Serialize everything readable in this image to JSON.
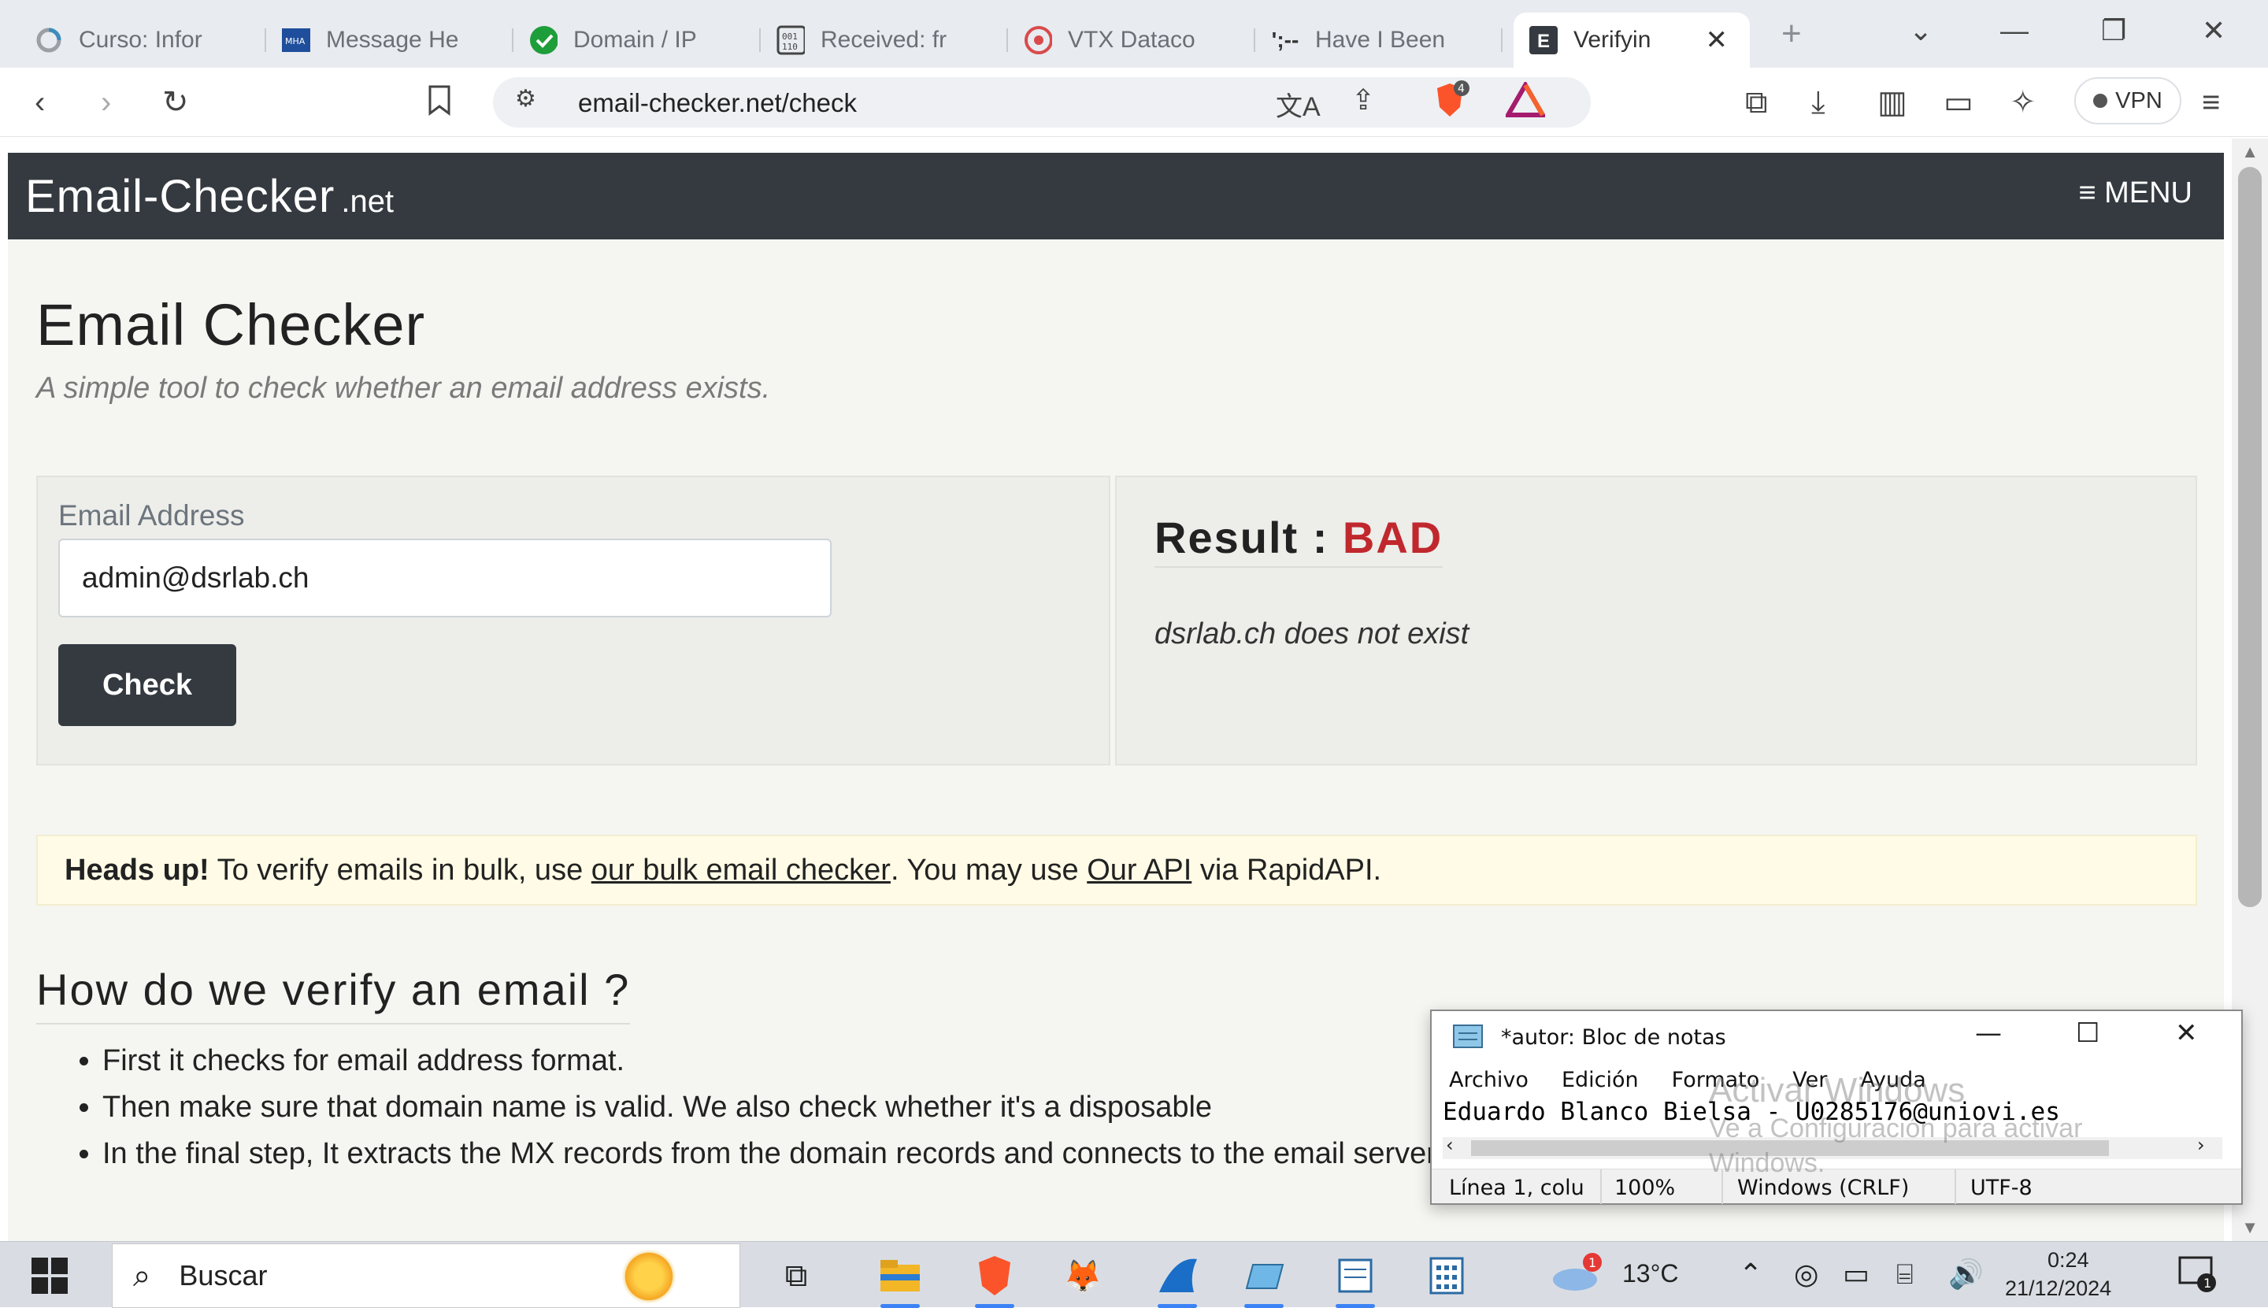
{
  "browser": {
    "tabs": [
      {
        "title": "Curso: Infor",
        "icon": "spinner-icon"
      },
      {
        "title": "Message He",
        "icon": "mha-icon"
      },
      {
        "title": "Domain / IP",
        "icon": "check-shield-icon"
      },
      {
        "title": "Received: fr",
        "icon": "binary-icon"
      },
      {
        "title": "VTX Dataco",
        "icon": "vtx-icon"
      },
      {
        "title": "Have I Been",
        "icon": "pwned-icon"
      },
      {
        "title": "Verifyin",
        "icon": "e-favicon-icon",
        "active": true
      }
    ],
    "url": "email-checker.net/check",
    "brave_badge": "4",
    "vpn_label": "VPN"
  },
  "site": {
    "logo": "Email-Checker",
    "logo_suffix": ".net",
    "menu_label": "≡ MENU",
    "title": "Email Checker",
    "subtitle": "A simple tool to check whether an email address exists.",
    "form": {
      "label": "Email Address",
      "value": "admin@dsrlab.ch",
      "button": "Check"
    },
    "result": {
      "label": "Result : ",
      "status": "BAD",
      "message": "dsrlab.ch does not exist"
    },
    "alert": {
      "strong": "Heads up!",
      "text1": " To verify emails in bulk, use ",
      "link1": "our bulk email checker",
      "text2": ". You may use ",
      "link2": "Our API",
      "text3": " via RapidAPI."
    },
    "how": {
      "title": "How do we verify an email ?",
      "steps": [
        "First it checks for email address format.",
        "Then make sure that domain name is valid. We also check whether it's a disposable",
        "In the final step, It extracts the MX records from the domain records and connects to the email server (over SMTP and also"
      ]
    }
  },
  "notepad": {
    "title": "*autor: Bloc de notas",
    "menus": [
      "Archivo",
      "Edición",
      "Formato",
      "Ver",
      "Ayuda"
    ],
    "text": "Eduardo Blanco Bielsa - U0285176@uniovi.es",
    "status": {
      "position": "Línea 1, colu",
      "zoom": "100%",
      "line_endings": "Windows (CRLF)",
      "encoding": "UTF-8"
    }
  },
  "watermark": {
    "line1": "Activar Windows",
    "line2": "Ve a Configuración para activar",
    "line3": "Windows."
  },
  "taskbar": {
    "search_placeholder": "Buscar",
    "weather_temp": "13°C",
    "weather_badge": "1",
    "time": "0:24",
    "date": "21/12/2024",
    "notification_count": "1"
  }
}
